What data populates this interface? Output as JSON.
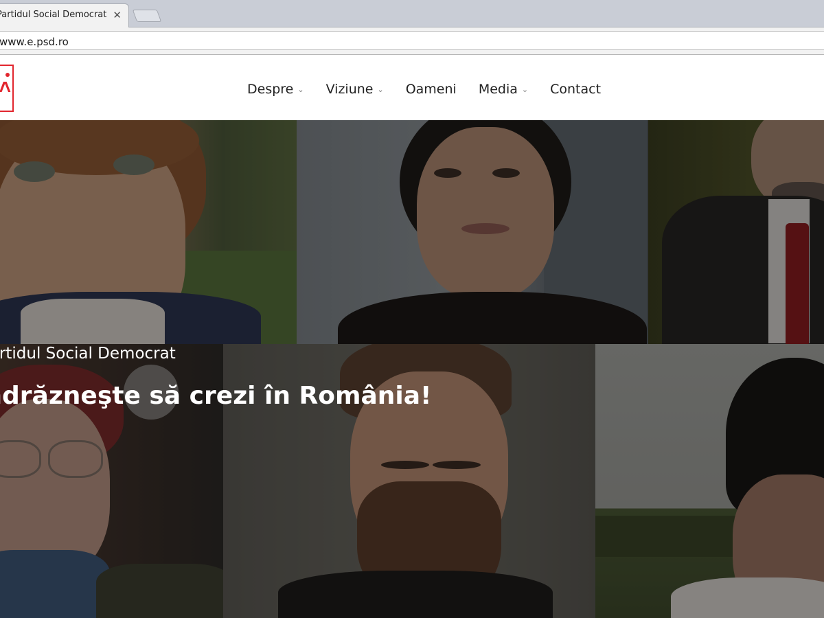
{
  "browser": {
    "tab_title": "Partidul Social Democrat",
    "tab_close": "✕",
    "address": "www.e.psd.ro"
  },
  "header": {
    "logo_alt": "PSD",
    "nav": [
      {
        "label": "Despre",
        "has_dropdown": true
      },
      {
        "label": "Viziune",
        "has_dropdown": true
      },
      {
        "label": "Oameni",
        "has_dropdown": false
      },
      {
        "label": "Media",
        "has_dropdown": true
      },
      {
        "label": "Contact",
        "has_dropdown": false
      }
    ],
    "chevron": "⌄"
  },
  "hero": {
    "subtitle": "Partidul Social Democrat",
    "title": "Îndrăzneşte să crezi în România!"
  },
  "colors": {
    "brand_red": "#e2262e",
    "nav_text": "#222222",
    "hero_text": "#ffffff"
  }
}
